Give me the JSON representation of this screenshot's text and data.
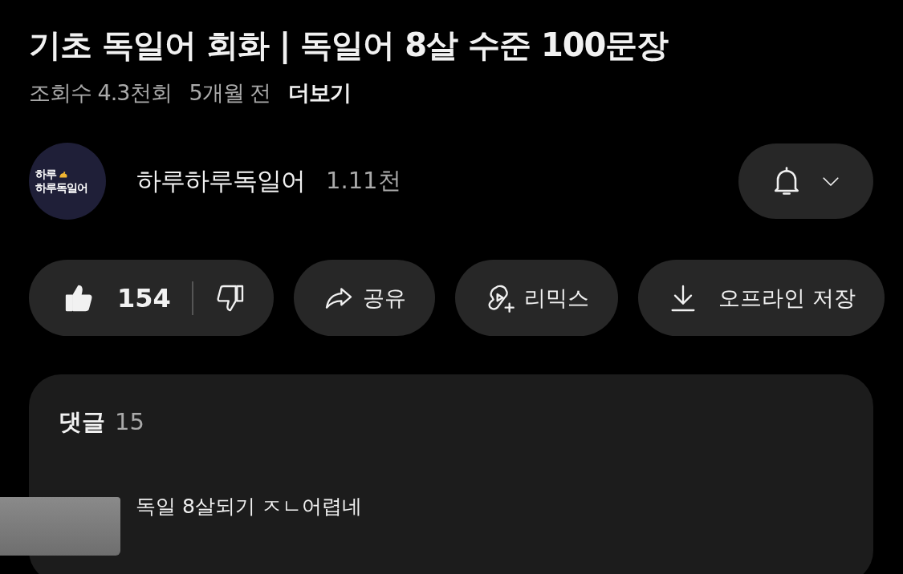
{
  "video": {
    "title": "기초 독일어 회화 | 독일어 8살 수준 100문장",
    "views": "조회수 4.3천회",
    "age": "5개월 전",
    "more": "더보기"
  },
  "channel": {
    "avatar_lines": [
      "하루",
      "하루독일어"
    ],
    "name": "하루하루독일어",
    "subscribers": "1.11천"
  },
  "actions": [
    {
      "kind": "like",
      "count": "154"
    },
    {
      "kind": "share",
      "label": "공유"
    },
    {
      "kind": "remix",
      "label": "리믹스"
    },
    {
      "kind": "download",
      "label": "오프라인 저장"
    }
  ],
  "comments": {
    "label": "댓글",
    "count": "15",
    "preview": "독일 8살되기 ㅈㄴ어렵네"
  }
}
